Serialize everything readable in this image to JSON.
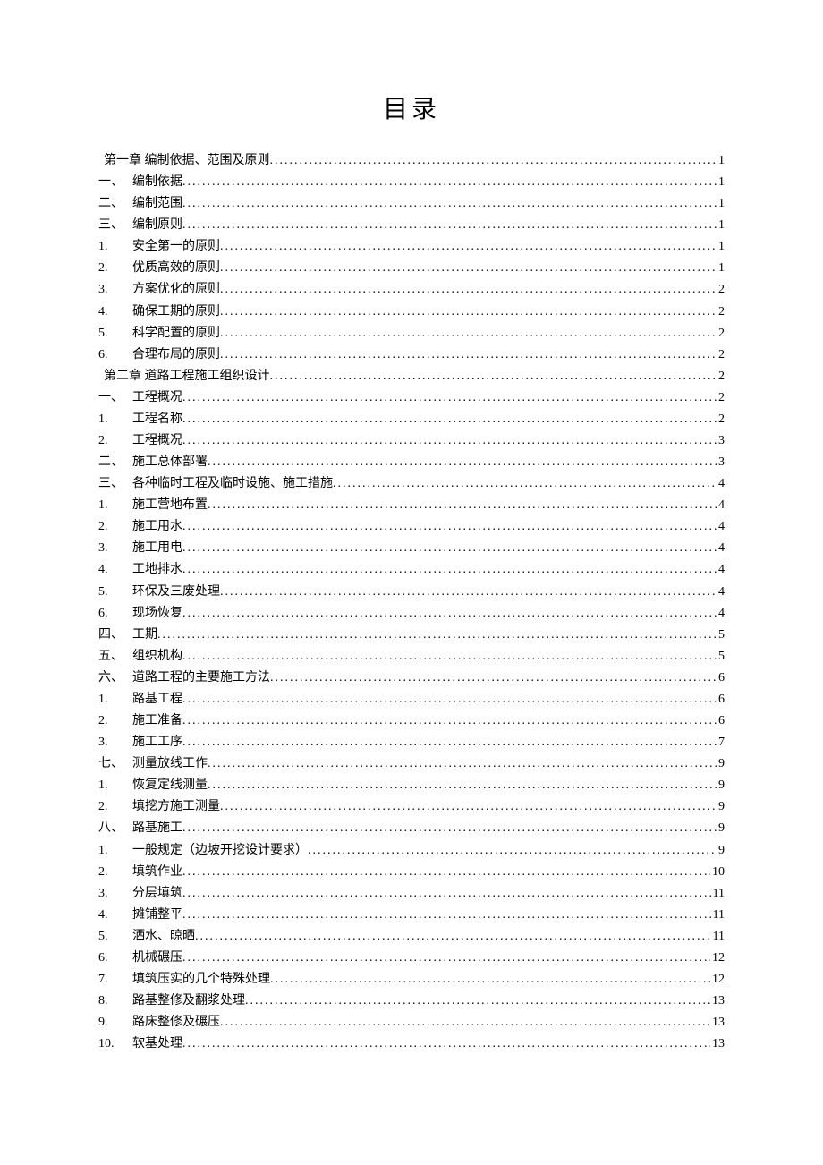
{
  "title": "目录",
  "entries": [
    {
      "label": "",
      "text": "第一章 编制依据、范围及原则",
      "page": "1",
      "indent": 0
    },
    {
      "label": "一、",
      "text": "编制依据",
      "page": "1",
      "indent": 1
    },
    {
      "label": "二、",
      "text": "编制范围",
      "page": "1",
      "indent": 1
    },
    {
      "label": "三、",
      "text": "编制原则",
      "page": "1",
      "indent": 1
    },
    {
      "label": "1.",
      "text": "安全第一的原则",
      "page": "1",
      "indent": 1
    },
    {
      "label": "2.",
      "text": "优质高效的原则",
      "page": "1",
      "indent": 1
    },
    {
      "label": "3.",
      "text": "方案优化的原则",
      "page": "2",
      "indent": 1
    },
    {
      "label": "4.",
      "text": "确保工期的原则",
      "page": "2",
      "indent": 1
    },
    {
      "label": "5.",
      "text": "科学配置的原则",
      "page": "2",
      "indent": 1
    },
    {
      "label": "6.",
      "text": "合理布局的原则",
      "page": "2",
      "indent": 1
    },
    {
      "label": "",
      "text": "第二章 道路工程施工组织设计",
      "page": "2",
      "indent": 0
    },
    {
      "label": "一、",
      "text": "工程概况",
      "page": "2",
      "indent": 1
    },
    {
      "label": "1.",
      "text": "工程名称",
      "page": "2",
      "indent": 1
    },
    {
      "label": "2.",
      "text": "工程概况",
      "page": "3",
      "indent": 1
    },
    {
      "label": "二、",
      "text": "施工总体部署",
      "page": "3",
      "indent": 1
    },
    {
      "label": "三、",
      "text": "各种临时工程及临时设施、施工措施",
      "page": "4",
      "indent": 1
    },
    {
      "label": "1.",
      "text": "施工营地布置",
      "page": "4",
      "indent": 1
    },
    {
      "label": "2.",
      "text": "施工用水",
      "page": "4",
      "indent": 1
    },
    {
      "label": "3.",
      "text": "施工用电",
      "page": "4",
      "indent": 1
    },
    {
      "label": "4.",
      "text": "工地排水",
      "page": "4",
      "indent": 1
    },
    {
      "label": "5.",
      "text": "环保及三废处理",
      "page": "4",
      "indent": 1
    },
    {
      "label": "6.",
      "text": "现场恢复",
      "page": "4",
      "indent": 1
    },
    {
      "label": "四、",
      "text": "工期",
      "page": "5",
      "indent": 1
    },
    {
      "label": "五、",
      "text": "组织机构",
      "page": "5",
      "indent": 1
    },
    {
      "label": "六、",
      "text": "道路工程的主要施工方法",
      "page": "6",
      "indent": 1
    },
    {
      "label": "1.",
      "text": "路基工程",
      "page": "6",
      "indent": 1
    },
    {
      "label": "2.",
      "text": "施工准备",
      "page": "6",
      "indent": 1
    },
    {
      "label": "3.",
      "text": "施工工序",
      "page": "7",
      "indent": 1
    },
    {
      "label": "七、",
      "text": "测量放线工作",
      "page": "9",
      "indent": 1
    },
    {
      "label": "1.",
      "text": "恢复定线测量",
      "page": "9",
      "indent": 1
    },
    {
      "label": "2.",
      "text": "填挖方施工测量",
      "page": "9",
      "indent": 1
    },
    {
      "label": "八、",
      "text": "路基施工",
      "page": "9",
      "indent": 1
    },
    {
      "label": "1.",
      "text": "一般规定（边坡开挖设计要求）",
      "page": "9",
      "indent": 1
    },
    {
      "label": "2.",
      "text": "填筑作业",
      "page": "10",
      "indent": 1
    },
    {
      "label": "3.",
      "text": "分层填筑",
      "page": "11",
      "indent": 1
    },
    {
      "label": "4.",
      "text": "摊铺整平",
      "page": "11",
      "indent": 1
    },
    {
      "label": "5.",
      "text": "洒水、晾晒",
      "page": "11",
      "indent": 1
    },
    {
      "label": "6.",
      "text": "机械碾压",
      "page": "12",
      "indent": 1
    },
    {
      "label": "7.",
      "text": "填筑压实的几个特殊处理",
      "page": "12",
      "indent": 1
    },
    {
      "label": "8.",
      "text": "路基整修及翻浆处理",
      "page": "13",
      "indent": 1
    },
    {
      "label": "9.",
      "text": "路床整修及碾压",
      "page": "13",
      "indent": 1
    },
    {
      "label": "10.",
      "text": "软基处理",
      "page": "13",
      "indent": 1
    }
  ]
}
